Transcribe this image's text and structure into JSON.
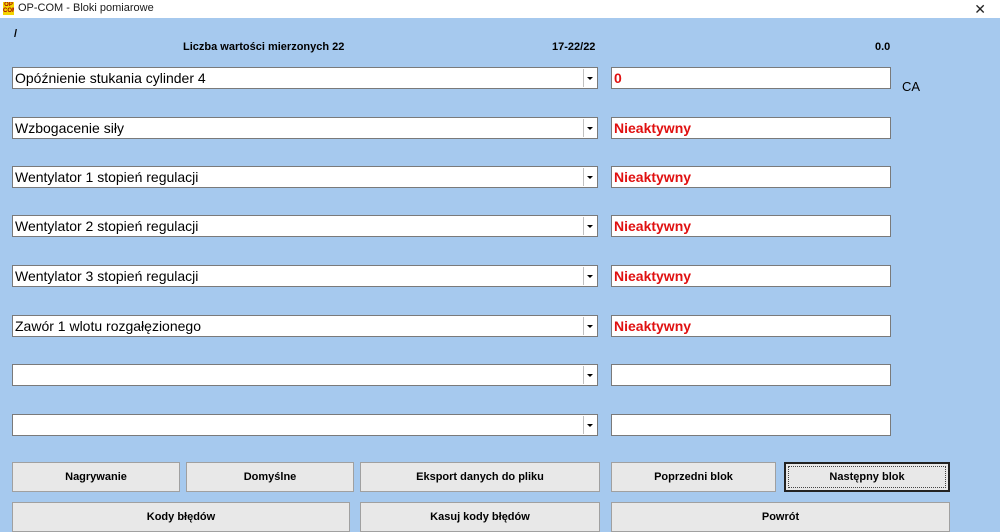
{
  "window": {
    "title": "OP-COM - Bloki pomiarowe",
    "logo_text": "OP COM"
  },
  "header": {
    "slash": "/",
    "count_label": "Liczba wartości mierzonych 22",
    "range": "17-22/22",
    "value": "0.0"
  },
  "rows": [
    {
      "param": "Opóźnienie stukania cylinder 4",
      "value": "0",
      "unit": "CA"
    },
    {
      "param": "Wzbogacenie siły",
      "value": "Nieaktywny",
      "unit": ""
    },
    {
      "param": "Wentylator 1 stopień regulacji",
      "value": "Nieaktywny",
      "unit": ""
    },
    {
      "param": "Wentylator 2 stopień regulacji",
      "value": "Nieaktywny",
      "unit": ""
    },
    {
      "param": "Wentylator 3 stopień regulacji",
      "value": "Nieaktywny",
      "unit": ""
    },
    {
      "param": "Zawór 1 wlotu rozgałęzionego",
      "value": "Nieaktywny",
      "unit": ""
    },
    {
      "param": "",
      "value": "",
      "unit": ""
    },
    {
      "param": "",
      "value": "",
      "unit": ""
    }
  ],
  "buttons": {
    "record": "Nagrywanie",
    "defaults": "Domyślne",
    "export": "Eksport danych do pliku",
    "prev_block": "Poprzedni blok",
    "next_block": "Następny blok",
    "error_codes": "Kody błędów",
    "clear_codes": "Kasuj kody błędów",
    "back": "Powrót"
  },
  "icons": {
    "close": "close-icon",
    "dropdown": "chevron-down-icon"
  },
  "colors": {
    "background": "#a6c9ee",
    "value_text": "#e01010"
  }
}
